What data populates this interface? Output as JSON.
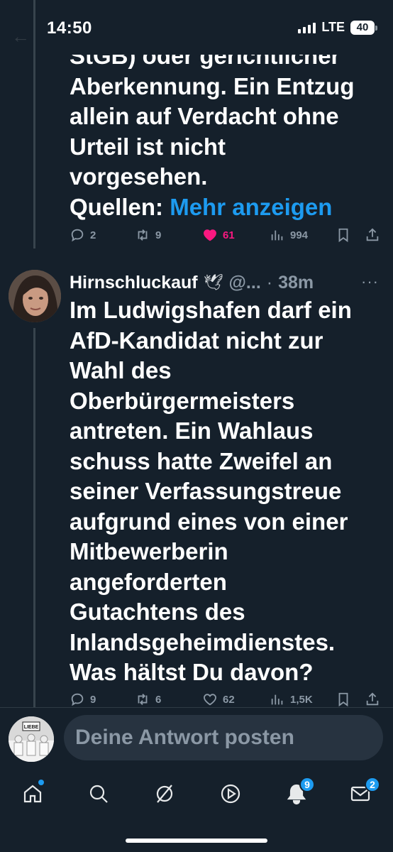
{
  "status": {
    "time": "14:50",
    "network": "LTE",
    "battery": "40"
  },
  "previous_tweet": {
    "text_lines": [
      "StGB) oder gerichtlicher",
      "Aberkennung. Ein Entzug",
      "allein auf Verdacht ohne",
      "Urteil ist nicht",
      "vorgesehen."
    ],
    "sources_label": "Quellen:",
    "more_link": "Mehr anzeigen",
    "stats": {
      "replies": "2",
      "retweets": "9",
      "likes": "61",
      "views": "994"
    }
  },
  "tweet": {
    "author": "Hirnschluckauf",
    "handle": "@...",
    "separator": "·",
    "time": "38m",
    "more": "···",
    "text_lines": [
      "Im Ludwigshafen darf ein",
      "AfD-Kandidat nicht zur",
      "Wahl des",
      "Oberbürgermeisters",
      "antreten. Ein Wahlaus",
      "schuss hatte Zweifel an",
      "seiner Verfassungstreue",
      "aufgrund eines von einer",
      "Mitbewerberin",
      "angeforderten",
      "Gutachtens des",
      "Inlandsgeheimdienstes.",
      "Was hältst Du davon?"
    ],
    "stats": {
      "replies": "9",
      "retweets": "6",
      "likes": "62",
      "views": "1,5K"
    }
  },
  "reply": {
    "placeholder": "Deine Antwort posten",
    "avatar_sign": "LIEBE"
  },
  "nav": {
    "notifications_badge": "9",
    "messages_badge": "2"
  },
  "colors": {
    "background": "#15202b",
    "accent": "#1d9bf0",
    "like": "#f91880",
    "muted": "#8b98a5"
  }
}
